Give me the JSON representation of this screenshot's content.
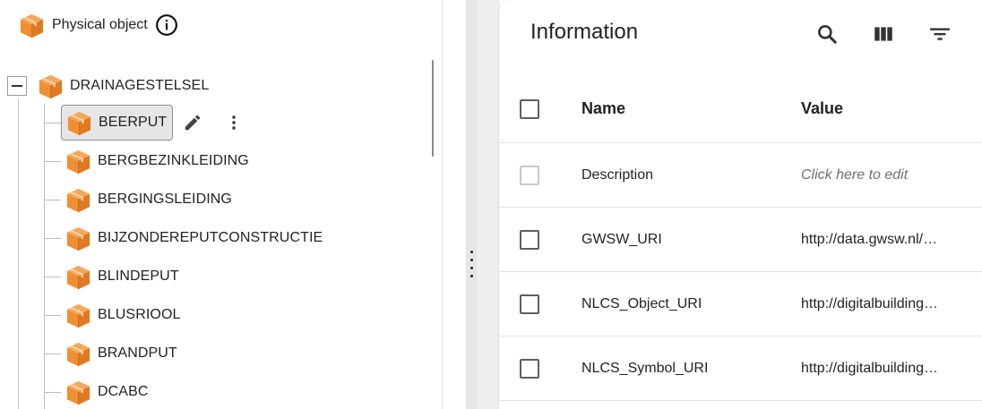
{
  "tree": {
    "header": {
      "title": "Physical object",
      "icon": "cube-icon",
      "info_icon": "info-icon"
    },
    "root": {
      "label": "DRAINAGESTELSEL",
      "expanded": true
    },
    "children": [
      {
        "label": "BEERPUT",
        "selected": true
      },
      {
        "label": "BERGBEZINKLEIDING"
      },
      {
        "label": "BERGINGSLEIDING"
      },
      {
        "label": "BIJZONDEREPUTCONSTRUCTIE"
      },
      {
        "label": "BLINDEPUT"
      },
      {
        "label": "BLUSRIOOL"
      },
      {
        "label": "BRANDPUT"
      },
      {
        "label": "DCABC"
      }
    ],
    "selected_actions": [
      "pencil-icon",
      "more-vert-icon"
    ]
  },
  "info": {
    "title": "Information",
    "tools": [
      "search-icon",
      "columns-icon",
      "filter-icon"
    ],
    "columns": {
      "name": "Name",
      "value": "Value"
    },
    "rows": [
      {
        "name": "Description",
        "value": "Click here to edit",
        "placeholder": true,
        "disabled": true
      },
      {
        "name": "GWSW_URI",
        "value": "http://data.gwsw.nl/…"
      },
      {
        "name": "NLCS_Object_URI",
        "value": "http://digitalbuilding…"
      },
      {
        "name": "NLCS_Symbol_URI",
        "value": "http://digitalbuilding…"
      }
    ]
  },
  "colors": {
    "accent_orange": "#f0953a",
    "accent_dark": "#c9661b",
    "selection_bg": "#e6e6e6"
  }
}
